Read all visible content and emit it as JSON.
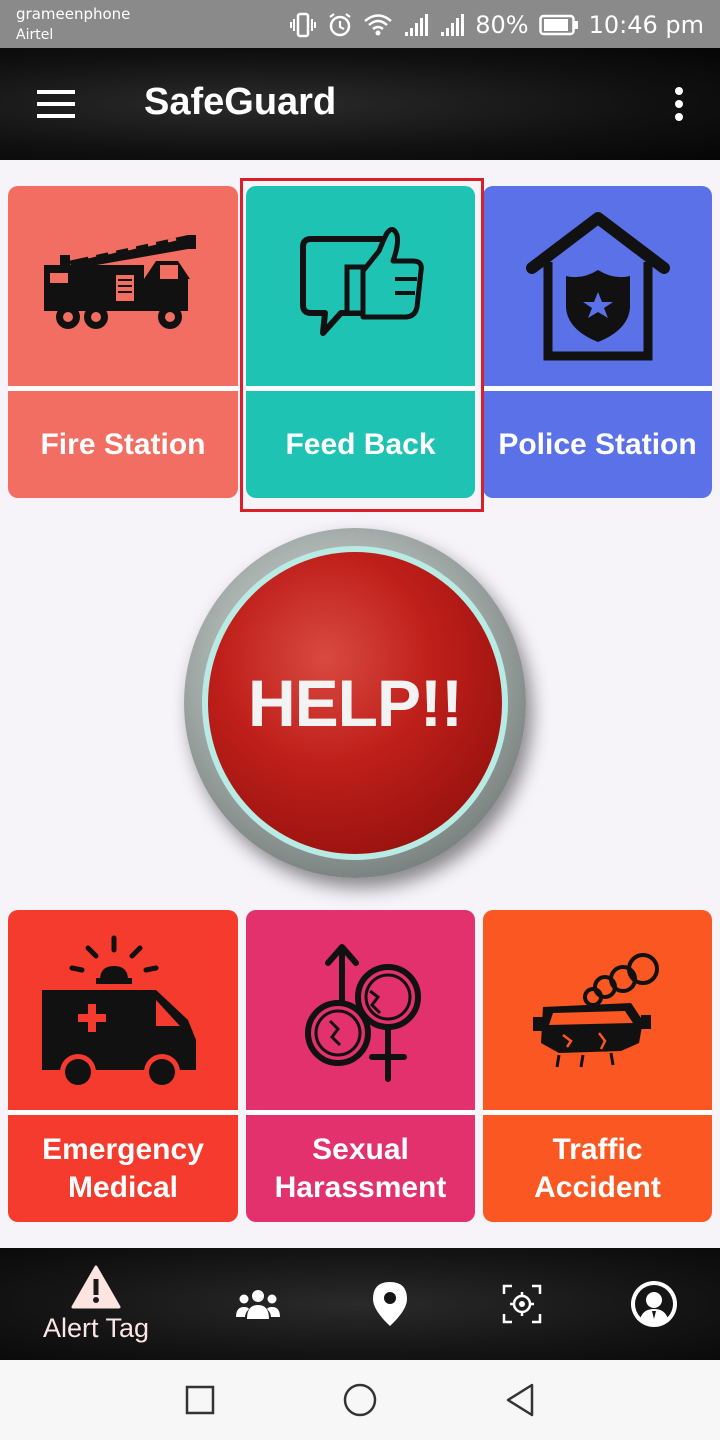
{
  "status_bar": {
    "carrier_primary": "grameenphone",
    "carrier_secondary": "Airtel",
    "battery_percent": "80%",
    "time": "10:46 pm",
    "icons": [
      "vibrate-icon",
      "alarm-icon",
      "wifi-icon",
      "signal-icon",
      "signal-icon",
      "battery-icon"
    ]
  },
  "app_bar": {
    "title": "SafeGuard",
    "menu_icon": "hamburger-menu-icon",
    "overflow_icon": "more-vert-icon"
  },
  "tiles": {
    "fire_station": {
      "label": "Fire Station",
      "icon": "fire-truck-icon",
      "color": "#f26d62"
    },
    "feed_back": {
      "label": "Feed Back",
      "icon": "feedback-thumbs-up-icon",
      "color": "#1fc3b3",
      "highlighted": true
    },
    "police_station": {
      "label": "Police Station",
      "icon": "police-station-icon",
      "color": "#5b71e8"
    },
    "emergency_medical": {
      "label": "Emergency\nMedical",
      "icon": "ambulance-icon",
      "color": "#f53a2e"
    },
    "sexual_harassment": {
      "label": "Sexual\nHarassment",
      "icon": "gender-broken-icon",
      "color": "#e3316d"
    },
    "traffic_accident": {
      "label": "Traffic\nAccident",
      "icon": "car-crash-icon",
      "color": "#fb5722"
    }
  },
  "help_button": {
    "label": "HELP!!"
  },
  "bottom_nav": {
    "items": [
      {
        "label": "Alert Tag",
        "icon": "alert-triangle-icon"
      },
      {
        "label": "",
        "icon": "people-group-icon"
      },
      {
        "label": "",
        "icon": "location-pin-icon"
      },
      {
        "label": "",
        "icon": "crosshair-icon"
      },
      {
        "label": "",
        "icon": "profile-avatar-icon"
      }
    ]
  },
  "system_nav": {
    "items": [
      "recents-square-icon",
      "home-circle-icon",
      "back-triangle-icon"
    ]
  }
}
